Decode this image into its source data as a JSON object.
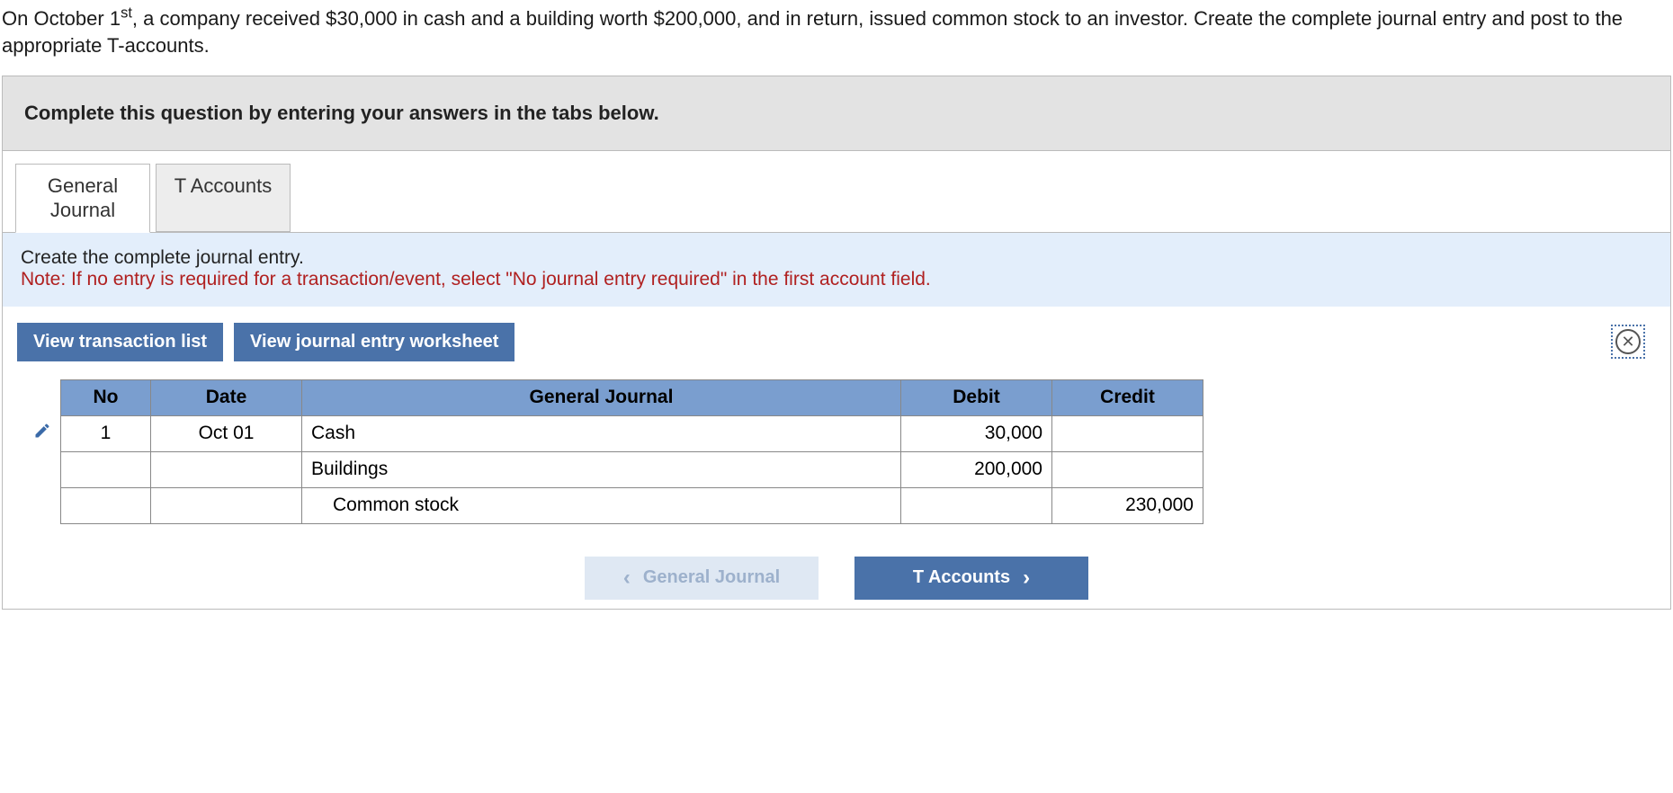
{
  "question": {
    "html": "On October 1<sup>st</sup>, a company received $30,000 in cash and a building worth $200,000, and in return, issued common stock to an investor. Create the complete journal entry and post to the appropriate T-accounts."
  },
  "instructions_bar": "Complete this question by entering your answers in the tabs below.",
  "tabs": {
    "general_journal": "General\nJournal",
    "t_accounts": "T Accounts"
  },
  "panel": {
    "prompt": "Create the complete journal entry.",
    "note": "Note: If no entry is required for a transaction/event, select \"No journal entry required\" in the first account field."
  },
  "buttons": {
    "view_transaction_list": "View transaction list",
    "view_worksheet": "View journal entry worksheet"
  },
  "journal": {
    "headers": {
      "no": "No",
      "date": "Date",
      "gj": "General Journal",
      "debit": "Debit",
      "credit": "Credit"
    },
    "rows": [
      {
        "no": "1",
        "date": "Oct 01",
        "account": "Cash",
        "indent": 1,
        "debit": "30,000",
        "credit": ""
      },
      {
        "no": "",
        "date": "",
        "account": "Buildings",
        "indent": 1,
        "debit": "200,000",
        "credit": ""
      },
      {
        "no": "",
        "date": "",
        "account": "Common stock",
        "indent": 2,
        "debit": "",
        "credit": "230,000"
      }
    ]
  },
  "footer": {
    "prev_label": "General Journal",
    "next_label": "T Accounts"
  }
}
